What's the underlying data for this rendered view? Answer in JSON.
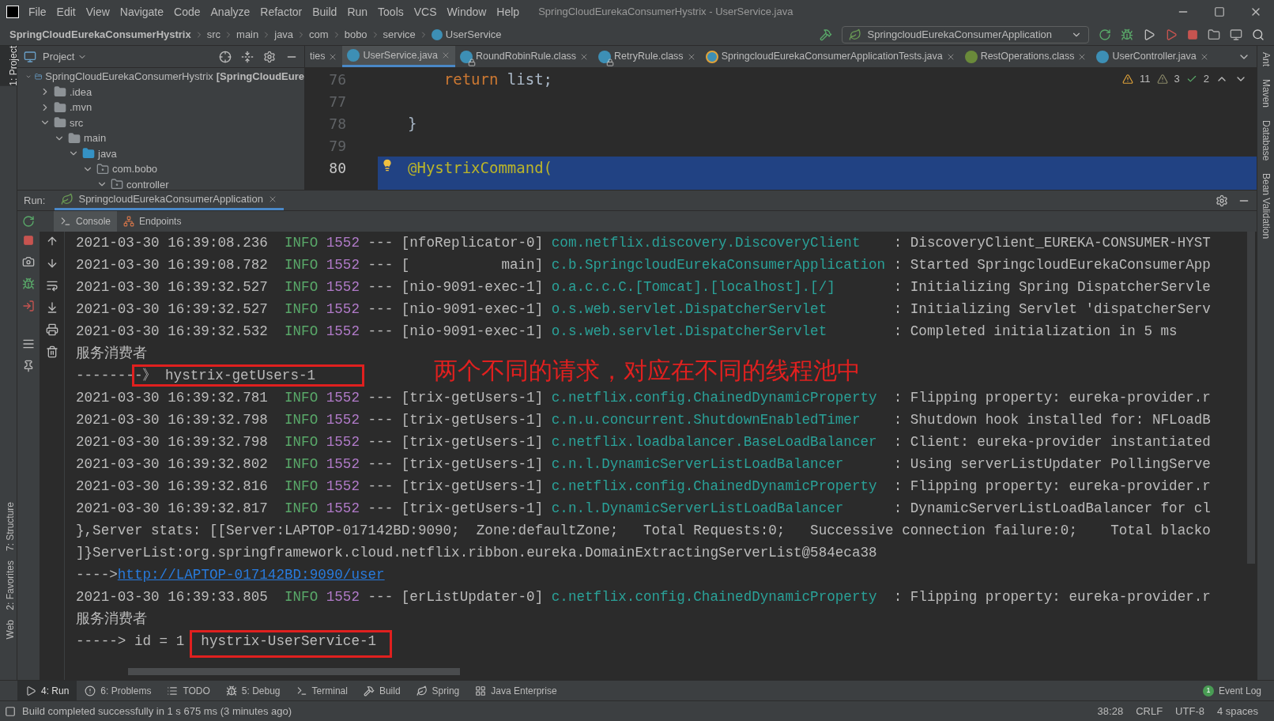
{
  "title_bar": {
    "menu": [
      "File",
      "Edit",
      "View",
      "Navigate",
      "Code",
      "Analyze",
      "Refactor",
      "Build",
      "Run",
      "Tools",
      "VCS",
      "Window",
      "Help"
    ],
    "title": "SpringCloudEurekaConsumerHystrix - UserService.java"
  },
  "nav_bar": {
    "breadcrumbs": [
      {
        "label": "SpringCloudEurekaConsumerHystrix",
        "kind": "project"
      },
      {
        "label": "src",
        "kind": "folder"
      },
      {
        "label": "main",
        "kind": "folder"
      },
      {
        "label": "java",
        "kind": "folder"
      },
      {
        "label": "com",
        "kind": "folder"
      },
      {
        "label": "bobo",
        "kind": "folder"
      },
      {
        "label": "service",
        "kind": "folder"
      },
      {
        "label": "UserService",
        "kind": "class"
      }
    ],
    "run_config": "SpringcloudEurekaConsumerApplication"
  },
  "left_tools_top": [
    {
      "label": "1: Project",
      "selected": true
    }
  ],
  "left_tools_bottom": [
    {
      "label": "7: Structure",
      "selected": false
    },
    {
      "label": "2: Favorites",
      "selected": false
    },
    {
      "label": "Web",
      "selected": false
    }
  ],
  "right_tools": [
    {
      "label": "Ant"
    },
    {
      "label": "Maven"
    },
    {
      "label": "Database"
    },
    {
      "label": "Bean Validation"
    }
  ],
  "project_panel": {
    "title": "Project",
    "tree": [
      {
        "label": "SpringCloudEurekaConsumerHystrix",
        "suffix": "[SpringCloudEure",
        "kind": "module",
        "expanded": true,
        "children": [
          {
            "label": ".idea",
            "kind": "folder",
            "expanded": false
          },
          {
            "label": ".mvn",
            "kind": "folder",
            "expanded": false
          },
          {
            "label": "src",
            "kind": "folder",
            "expanded": true,
            "children": [
              {
                "label": "main",
                "kind": "folder",
                "expanded": true,
                "children": [
                  {
                    "label": "java",
                    "kind": "source",
                    "expanded": true,
                    "children": [
                      {
                        "label": "com.bobo",
                        "kind": "package",
                        "expanded": true,
                        "children": [
                          {
                            "label": "controller",
                            "kind": "package",
                            "expanded": true
                          }
                        ]
                      }
                    ]
                  }
                ]
              }
            ]
          }
        ]
      }
    ]
  },
  "editor_tabs": [
    {
      "label": "ties",
      "kind": "partial",
      "selected": false
    },
    {
      "label": "UserService.java",
      "kind": "class",
      "selected": true
    },
    {
      "label": "RoundRobinRule.class",
      "kind": "locked",
      "selected": false
    },
    {
      "label": "RetryRule.class",
      "kind": "locked",
      "selected": false
    },
    {
      "label": "SpringcloudEurekaConsumerApplicationTests.java",
      "kind": "test",
      "selected": false
    },
    {
      "label": "RestOperations.class",
      "kind": "interface",
      "selected": false
    },
    {
      "label": "UserController.java",
      "kind": "class",
      "selected": false
    }
  ],
  "inspections": {
    "warnings": "11",
    "weak_warnings": "3",
    "typos": "2"
  },
  "editor": {
    "lines": [
      {
        "number": "76",
        "highlighted": false,
        "tokens": [
          {
            "text": "    return",
            "kind": "keyword"
          },
          {
            "text": " list;",
            "kind": "plain"
          }
        ]
      },
      {
        "number": "77",
        "highlighted": false
      },
      {
        "number": "78",
        "highlighted": false,
        "tokens": [
          {
            "text": "}",
            "kind": "plain"
          }
        ]
      },
      {
        "number": "79",
        "highlighted": false
      },
      {
        "number": "80",
        "highlighted": true,
        "tokens": [
          {
            "text": "@HystrixCommand(",
            "kind": "annotation"
          }
        ]
      }
    ]
  },
  "run_panel": {
    "label": "Run:",
    "tabs": [
      {
        "label": "SpringcloudEurekaConsumerApplication",
        "selected": true
      }
    ],
    "console_tabs": [
      {
        "label": "Console",
        "kind": "console",
        "selected": true
      },
      {
        "label": "Endpoints",
        "kind": "endpoints",
        "selected": false
      }
    ],
    "annotation": "两个不同的请求，对应在不同的线程池中",
    "lines": [
      {
        "kind": "log",
        "time": "2021-03-30 16:39:08.236",
        "level": "INFO",
        "pid": "1552",
        "sep": "---",
        "thread": "[nfoReplicator-0]",
        "logger": "com.netflix.discovery.DiscoveryClient",
        "message": ": DiscoveryClient_EUREKA-CONSUMER-HYST"
      },
      {
        "kind": "log",
        "time": "2021-03-30 16:39:08.782",
        "level": "INFO",
        "pid": "1552",
        "sep": "---",
        "thread": "[           main]",
        "logger": "c.b.SpringcloudEurekaConsumerApplication",
        "message": ": Started SpringcloudEurekaConsumerApp"
      },
      {
        "kind": "log",
        "time": "2021-03-30 16:39:32.527",
        "level": "INFO",
        "pid": "1552",
        "sep": "---",
        "thread": "[nio-9091-exec-1]",
        "logger": "o.a.c.c.C.[Tomcat].[localhost].[/]",
        "message": ": Initializing Spring DispatcherServle"
      },
      {
        "kind": "log",
        "time": "2021-03-30 16:39:32.527",
        "level": "INFO",
        "pid": "1552",
        "sep": "---",
        "thread": "[nio-9091-exec-1]",
        "logger": "o.s.web.servlet.DispatcherServlet",
        "message": ": Initializing Servlet 'dispatcherServ"
      },
      {
        "kind": "log",
        "time": "2021-03-30 16:39:32.532",
        "level": "INFO",
        "pid": "1552",
        "sep": "---",
        "thread": "[nio-9091-exec-1]",
        "logger": "o.s.web.servlet.DispatcherServlet",
        "message": ": Completed initialization in 5 ms"
      },
      {
        "kind": "text",
        "text": "服务消费者"
      },
      {
        "kind": "boxed",
        "text": "--------》",
        "boxed": "hystrix-getUsers-1"
      },
      {
        "kind": "log",
        "time": "2021-03-30 16:39:32.781",
        "level": "INFO",
        "pid": "1552",
        "sep": "---",
        "thread": "[trix-getUsers-1]",
        "logger": "c.netflix.config.ChainedDynamicProperty",
        "message": ": Flipping property: eureka-provider.r"
      },
      {
        "kind": "log",
        "time": "2021-03-30 16:39:32.798",
        "level": "INFO",
        "pid": "1552",
        "sep": "---",
        "thread": "[trix-getUsers-1]",
        "logger": "c.n.u.concurrent.ShutdownEnabledTimer",
        "message": ": Shutdown hook installed for: NFLoadB"
      },
      {
        "kind": "log",
        "time": "2021-03-30 16:39:32.798",
        "level": "INFO",
        "pid": "1552",
        "sep": "---",
        "thread": "[trix-getUsers-1]",
        "logger": "c.netflix.loadbalancer.BaseLoadBalancer",
        "message": ": Client: eureka-provider instantiated"
      },
      {
        "kind": "log",
        "time": "2021-03-30 16:39:32.802",
        "level": "INFO",
        "pid": "1552",
        "sep": "---",
        "thread": "[trix-getUsers-1]",
        "logger": "c.n.l.DynamicServerListLoadBalancer",
        "message": ": Using serverListUpdater PollingServe"
      },
      {
        "kind": "log",
        "time": "2021-03-30 16:39:32.816",
        "level": "INFO",
        "pid": "1552",
        "sep": "---",
        "thread": "[trix-getUsers-1]",
        "logger": "c.netflix.config.ChainedDynamicProperty",
        "message": ": Flipping property: eureka-provider.r"
      },
      {
        "kind": "log",
        "time": "2021-03-30 16:39:32.817",
        "level": "INFO",
        "pid": "1552",
        "sep": "---",
        "thread": "[trix-getUsers-1]",
        "logger": "c.n.l.DynamicServerListLoadBalancer",
        "message": ": DynamicServerListLoadBalancer for cl"
      },
      {
        "kind": "text",
        "text": "},Server stats: [[Server:LAPTOP-017142BD:9090;  Zone:defaultZone;   Total Requests:0;   Successive connection failure:0;    Total blacko"
      },
      {
        "kind": "text",
        "text": "]}ServerList:org.springframework.cloud.netflix.ribbon.eureka.DomainExtractingServerList@584eca38"
      },
      {
        "kind": "link",
        "text": "---->",
        "url": "http://LAPTOP-017142BD:9090/user"
      },
      {
        "kind": "log",
        "time": "2021-03-30 16:39:33.805",
        "level": "INFO",
        "pid": "1552",
        "sep": "---",
        "thread": "[erListUpdater-0]",
        "logger": "c.netflix.config.ChainedDynamicProperty",
        "message": ": Flipping property: eureka-provider.r"
      },
      {
        "kind": "text",
        "text": "服务消费者"
      },
      {
        "kind": "boxed",
        "text": "-----> id = 1",
        "boxed": "hystrix-UserService-1"
      }
    ]
  },
  "bottom_tabs": [
    {
      "label": "4: Run",
      "kind": "run",
      "selected": true
    },
    {
      "label": "6: Problems",
      "kind": "problems",
      "selected": false
    },
    {
      "label": "TODO",
      "kind": "todo",
      "selected": false
    },
    {
      "label": "5: Debug",
      "kind": "debug",
      "selected": false
    },
    {
      "label": "Terminal",
      "kind": "terminal",
      "selected": false
    },
    {
      "label": "Build",
      "kind": "build",
      "selected": false
    },
    {
      "label": "Spring",
      "kind": "spring",
      "selected": false
    },
    {
      "label": "Java Enterprise",
      "kind": "enterprise",
      "selected": false
    }
  ],
  "event_log": {
    "label": "Event Log",
    "count": "1"
  },
  "status_bar": {
    "message": "Build completed successfully in 1 s 675 ms (3 minutes ago)",
    "items": [
      "38:28",
      "CRLF",
      "UTF-8",
      "4 spaces"
    ]
  }
}
